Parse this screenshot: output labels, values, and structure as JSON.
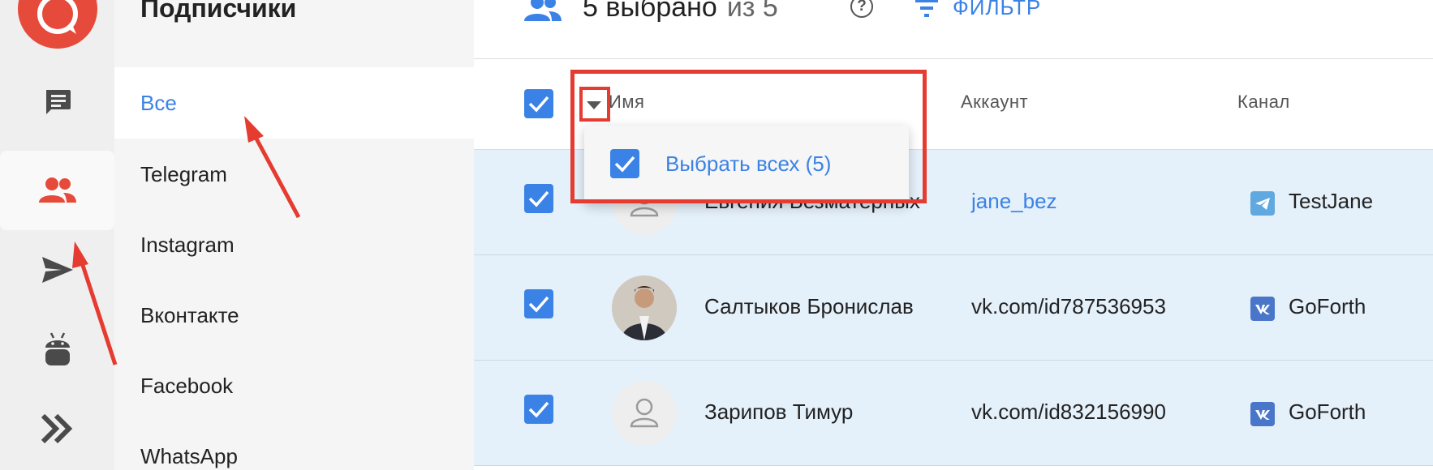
{
  "panel": {
    "title": "Подписчики",
    "categories": [
      {
        "label": "Все",
        "active": true
      },
      {
        "label": "Telegram",
        "active": false
      },
      {
        "label": "Instagram",
        "active": false
      },
      {
        "label": "Вконтакте",
        "active": false
      },
      {
        "label": "Facebook",
        "active": false
      },
      {
        "label": "WhatsApp",
        "active": false
      }
    ]
  },
  "rail": {
    "icons": [
      "chat-icon",
      "subscribers-icon",
      "send-icon",
      "bot-icon",
      "flows-icon"
    ],
    "active": "subscribers-icon"
  },
  "toolbar": {
    "selected_text": "5 выбрано",
    "of_text": "из 5",
    "help_text": "?",
    "filter_label": "ФИЛЬТР"
  },
  "table": {
    "columns": {
      "name": "Имя",
      "account": "Аккаунт",
      "channel": "Канал"
    },
    "rows": [
      {
        "name": "Евгения Безматерных",
        "account": "jane_bez",
        "account_is_link": true,
        "channel": "TestJane",
        "channel_icon": "telegram-icon",
        "avatar": "placeholder",
        "checked": true
      },
      {
        "name": "Салтыков Бронислав",
        "account": "vk.com/id787536953",
        "account_is_link": false,
        "channel": "GoForth",
        "channel_icon": "vk-icon",
        "avatar": "photo",
        "checked": true
      },
      {
        "name": "Зарипов Тимур",
        "account": "vk.com/id832156990",
        "account_is_link": false,
        "channel": "GoForth",
        "channel_icon": "vk-icon",
        "avatar": "placeholder",
        "checked": true
      }
    ]
  },
  "dropdown": {
    "select_all_label": "Выбрать всех (5)",
    "checked": true
  },
  "colors": {
    "accent": "#3b82e6",
    "brand": "#e64a3a",
    "annotation": "#e53b30",
    "row_selected": "#e4f0fa"
  }
}
